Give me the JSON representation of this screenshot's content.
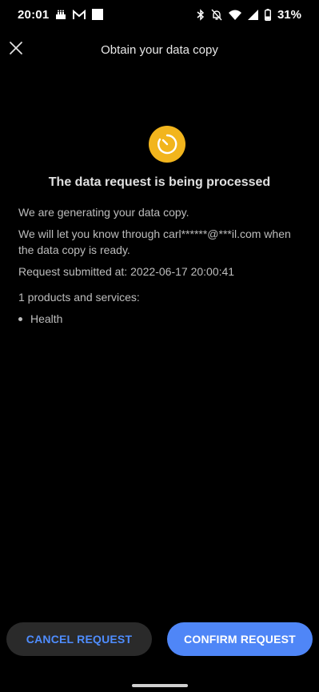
{
  "status_bar": {
    "time": "20:01",
    "battery_percent": "31%",
    "icons": [
      "cake-icon",
      "gmail-icon",
      "white-square-icon",
      "bluetooth-icon",
      "mute-bell-icon",
      "wifi-icon",
      "signal-icon",
      "battery-icon"
    ]
  },
  "app_bar": {
    "title": "Obtain your data copy",
    "close_icon": "close-icon"
  },
  "status": {
    "icon": "clock-processing-icon",
    "icon_color": "#f2b51d",
    "headline": "The data request is being processed",
    "message_generating": "We are generating your data copy.",
    "message_notify": "We will let you know through carl******@***il.com when the data copy is ready.",
    "submitted_at": "Request submitted at: 2022-06-17 20:00:41",
    "products_count_label": "1 products and services:",
    "services": [
      "Health"
    ]
  },
  "actions": {
    "cancel_label": "CANCEL REQUEST",
    "confirm_label": "CONFIRM REQUEST",
    "accent_color": "#4f86f7"
  }
}
